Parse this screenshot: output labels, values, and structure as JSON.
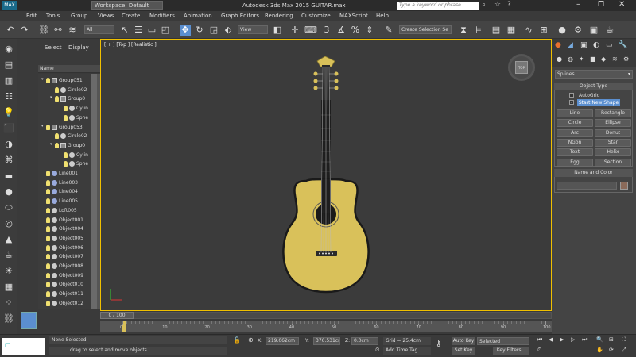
{
  "titlebar": {
    "workspace": "Workspace: Default",
    "title": "Autodesk 3ds Max  2015      GUITAR.max",
    "search_placeholder": "Type a keyword or phrase"
  },
  "menu": [
    "Edit",
    "Tools",
    "Group",
    "Views",
    "Create",
    "Modifiers",
    "Animation",
    "Graph Editors",
    "Rendering",
    "Customize",
    "MAXScript",
    "Help"
  ],
  "toolbar": {
    "filter": "All",
    "view": "View",
    "selection_set": "Create Selection Se"
  },
  "scene_explorer": {
    "tabs": [
      "Select",
      "Display"
    ],
    "column": "Name",
    "items": [
      {
        "label": "Group051",
        "indent": 0,
        "kind": "group"
      },
      {
        "label": "Circle02",
        "indent": 1,
        "kind": "ball"
      },
      {
        "label": "Group0",
        "indent": 1,
        "kind": "group"
      },
      {
        "label": "Cylin",
        "indent": 2,
        "kind": "ball"
      },
      {
        "label": "Sphe",
        "indent": 2,
        "kind": "ball"
      },
      {
        "label": "Group053",
        "indent": 0,
        "kind": "group"
      },
      {
        "label": "Circle02",
        "indent": 1,
        "kind": "ball"
      },
      {
        "label": "Group0",
        "indent": 1,
        "kind": "group"
      },
      {
        "label": "Cylin",
        "indent": 2,
        "kind": "ball"
      },
      {
        "label": "Sphe",
        "indent": 2,
        "kind": "ball"
      },
      {
        "label": "Line001",
        "indent": 0,
        "kind": "shape"
      },
      {
        "label": "Line003",
        "indent": 0,
        "kind": "shape"
      },
      {
        "label": "Line004",
        "indent": 0,
        "kind": "shape"
      },
      {
        "label": "Line005",
        "indent": 0,
        "kind": "shape"
      },
      {
        "label": "Loft005",
        "indent": 0,
        "kind": "ball"
      },
      {
        "label": "Object001",
        "indent": 0,
        "kind": "ball"
      },
      {
        "label": "Object004",
        "indent": 0,
        "kind": "ball"
      },
      {
        "label": "Object005",
        "indent": 0,
        "kind": "ball"
      },
      {
        "label": "Object006",
        "indent": 0,
        "kind": "ball"
      },
      {
        "label": "Object007",
        "indent": 0,
        "kind": "ball"
      },
      {
        "label": "Object008",
        "indent": 0,
        "kind": "ball"
      },
      {
        "label": "Object009",
        "indent": 0,
        "kind": "ball"
      },
      {
        "label": "Object010",
        "indent": 0,
        "kind": "ball"
      },
      {
        "label": "Object011",
        "indent": 0,
        "kind": "ball"
      },
      {
        "label": "Object012",
        "indent": 0,
        "kind": "ball"
      }
    ]
  },
  "viewport": {
    "label": "[ + ] [Top ] [Realistic ]",
    "viewcube": "TOP"
  },
  "command_panel": {
    "dropdown": "Splines",
    "object_type_title": "Object Type",
    "autogrid": "AutoGrid",
    "start_new_shape": "Start New Shape",
    "buttons": [
      "Line",
      "Rectangle",
      "Circle",
      "Ellipse",
      "Arc",
      "Donut",
      "NGon",
      "Star",
      "Text",
      "Helix",
      "Egg",
      "Section"
    ],
    "name_color_title": "Name and Color",
    "accent": "#8a6a5a"
  },
  "timeline": {
    "frame_label": "0 / 100",
    "ticks": [
      "0",
      "10",
      "20",
      "30",
      "40",
      "50",
      "60",
      "70",
      "80",
      "90",
      "100"
    ]
  },
  "status": {
    "selection": "None Selected",
    "prompt": "drag to select and move objects",
    "x_label": "X:",
    "x": "219.062cm",
    "y_label": "Y:",
    "y": "376.531cm",
    "z_label": "Z:",
    "z": "0.0cm",
    "grid": "Grid = 25.4cm",
    "add_time_tag": "Add Time Tag",
    "auto_key": "Auto Key",
    "selected": "Selected",
    "set_key": "Set Key",
    "key_filters": "Key Filters..."
  },
  "colors": {
    "guitar_body": "#d9c15a",
    "selection_border": "#f0c000"
  }
}
